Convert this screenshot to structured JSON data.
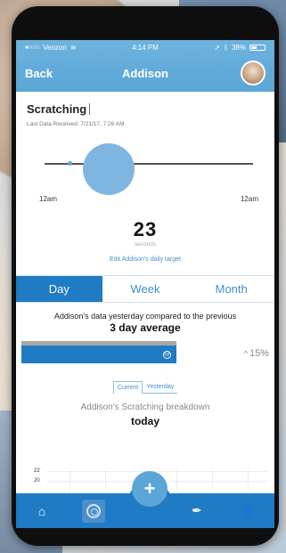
{
  "status": {
    "carrier": "Verizon",
    "time": "4:14 PM",
    "battery": "38%"
  },
  "nav": {
    "back_label": "Back",
    "title": "Addison"
  },
  "metric": {
    "name": "Scratching",
    "last_received": "Last Data Received: 7/21/17, 7:26 AM",
    "timeline_start": "12am",
    "timeline_end": "12am",
    "value": "23",
    "unit": "seconds",
    "edit_link": "Edit Addison's daily target"
  },
  "period_tabs": [
    {
      "label": "Day",
      "active": true
    },
    {
      "label": "Week",
      "active": false
    },
    {
      "label": "Month",
      "active": false
    }
  ],
  "comparison": {
    "line1": "Addison's data yesterday compared to the previous",
    "line2": "3 day average",
    "change": "15%",
    "change_direction": "up"
  },
  "segment": {
    "options": [
      "Current",
      "Yesterday"
    ],
    "selected": "Current"
  },
  "breakdown": {
    "title": "Addison's Scratching breakdown",
    "subtitle": "today",
    "y_ticks": [
      "22",
      "20"
    ]
  },
  "bottom_tabs": [
    {
      "icon": "home-icon",
      "active": false
    },
    {
      "icon": "target-icon",
      "active": true
    },
    {
      "icon": "add-icon",
      "active": false
    },
    {
      "icon": "feather-icon",
      "active": false
    },
    {
      "icon": "profile-icon",
      "active": false
    }
  ],
  "colors": {
    "header_blue": "#5aa6d6",
    "primary_blue": "#1f7bc4",
    "link_blue": "#3f8fcf"
  }
}
